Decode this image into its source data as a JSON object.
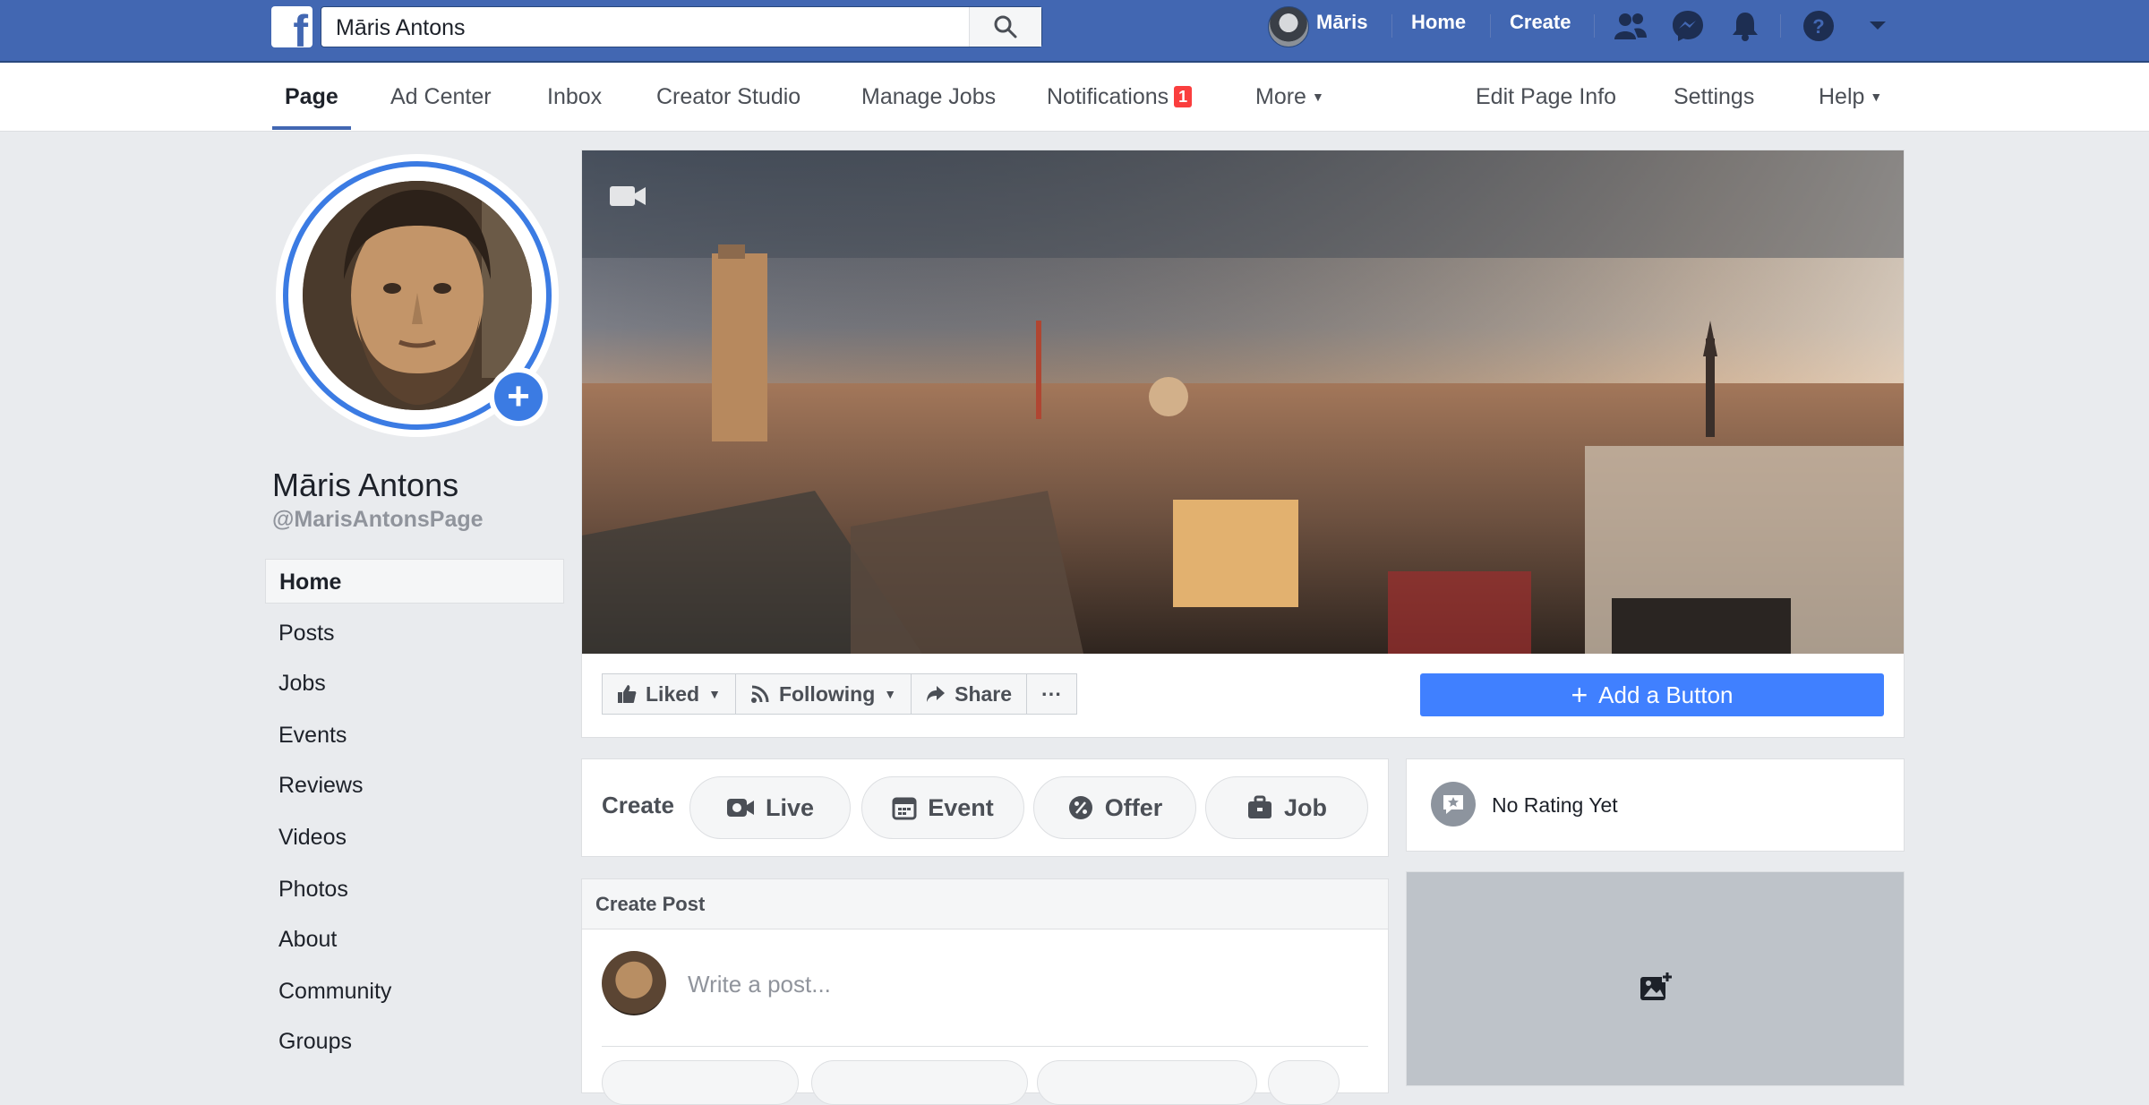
{
  "topbar": {
    "search_value": "Māris Antons",
    "user_name": "Māris",
    "home_label": "Home",
    "create_label": "Create",
    "brand_color": "#4267b2",
    "icons": [
      "facebook-logo-icon",
      "search-icon",
      "friend-requests-icon",
      "messenger-icon",
      "notifications-bell-icon",
      "help-icon",
      "account-menu-caret-icon"
    ]
  },
  "page_nav": {
    "items": [
      {
        "label": "Page"
      },
      {
        "label": "Ad Center"
      },
      {
        "label": "Inbox"
      },
      {
        "label": "Creator Studio"
      },
      {
        "label": "Manage Jobs"
      },
      {
        "label": "Notifications"
      },
      {
        "label": "More"
      }
    ],
    "notifications_count": "1",
    "right_items": [
      {
        "label": "Edit Page Info"
      },
      {
        "label": "Settings"
      },
      {
        "label": "Help"
      }
    ]
  },
  "profile": {
    "name": "Māris Antons",
    "handle": "@MarisAntonsPage"
  },
  "sidebar": {
    "items": [
      {
        "label": "Home"
      },
      {
        "label": "Posts"
      },
      {
        "label": "Jobs"
      },
      {
        "label": "Events"
      },
      {
        "label": "Reviews"
      },
      {
        "label": "Videos"
      },
      {
        "label": "Photos"
      },
      {
        "label": "About"
      },
      {
        "label": "Community"
      },
      {
        "label": "Groups"
      }
    ]
  },
  "actions": {
    "liked": "Liked",
    "following": "Following",
    "share": "Share",
    "more": "···",
    "add_button": "Add a Button",
    "accent_color": "#4080ff"
  },
  "create_row": {
    "label": "Create",
    "buttons": [
      {
        "label": "Live"
      },
      {
        "label": "Event"
      },
      {
        "label": "Offer"
      },
      {
        "label": "Job"
      }
    ]
  },
  "rating": {
    "text": "No Rating Yet"
  },
  "post": {
    "title": "Create Post",
    "placeholder": "Write a post..."
  }
}
